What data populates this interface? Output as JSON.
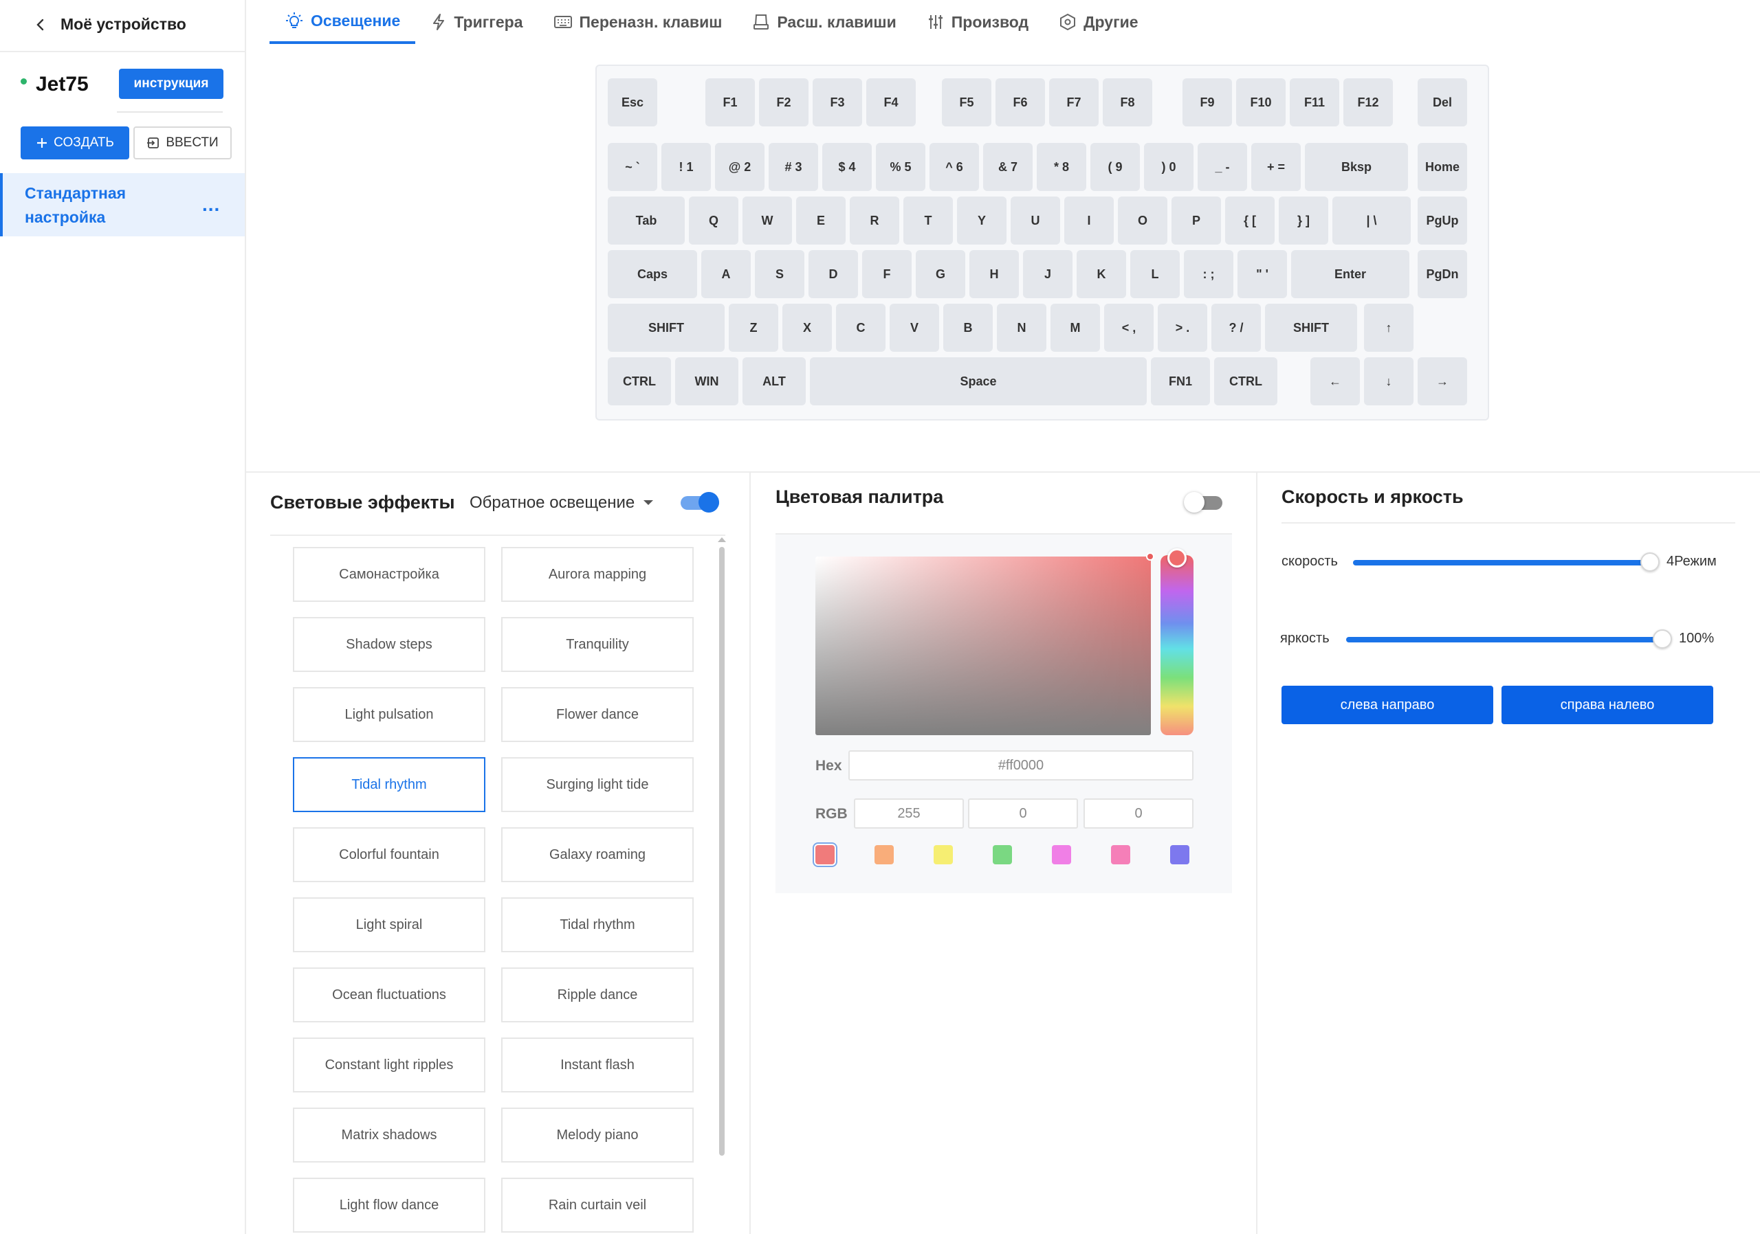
{
  "sidebar": {
    "back_title": "Моё устройство",
    "device_name": "Jet75",
    "instruction_label": "инструкция",
    "create_label": "СОЗДАТЬ",
    "import_label": "ВВЕСТИ",
    "profile_name": "Стандартная настройка",
    "profile_more": "..."
  },
  "tabs": [
    {
      "label": "Освещение",
      "icon": "bulb-icon",
      "active": true
    },
    {
      "label": "Триггера",
      "icon": "lightning-icon"
    },
    {
      "label": "Переназн. клавиш",
      "icon": "keyboard-icon"
    },
    {
      "label": "Расш. клавиши",
      "icon": "device-icon"
    },
    {
      "label": "Производ",
      "icon": "sliders-icon"
    },
    {
      "label": "Другие",
      "icon": "hexagon-settings-icon"
    }
  ],
  "keyboard": {
    "rows": [
      [
        "Esc",
        "F1",
        "F2",
        "F3",
        "F4",
        "F5",
        "F6",
        "F7",
        "F8",
        "F9",
        "F10",
        "F11",
        "F12",
        "Del"
      ],
      [
        "~ `",
        "! 1",
        "@ 2",
        "# 3",
        "$ 4",
        "% 5",
        "^ 6",
        "& 7",
        "* 8",
        "( 9",
        ") 0",
        "_ -",
        "+ =",
        "Bksp",
        "Home"
      ],
      [
        "Tab",
        "Q",
        "W",
        "E",
        "R",
        "T",
        "Y",
        "U",
        "I",
        "O",
        "P",
        "{ [",
        "} ]",
        "| \\",
        "PgUp"
      ],
      [
        "Caps",
        "A",
        "S",
        "D",
        "F",
        "G",
        "H",
        "J",
        "K",
        "L",
        ": ;",
        "\" '",
        "Enter",
        "PgDn"
      ],
      [
        "SHIFT",
        "Z",
        "X",
        "C",
        "V",
        "B",
        "N",
        "M",
        "< ,",
        "> .",
        "? /",
        "SHIFT",
        "↑"
      ],
      [
        "CTRL",
        "WIN",
        "ALT",
        "Space",
        "FN1",
        "CTRL",
        "←",
        "↓",
        "→"
      ]
    ]
  },
  "effects": {
    "title": "Световые эффекты",
    "mode": "Обратное освещение",
    "enabled": true,
    "selected": "Tidal rhythm",
    "items": [
      "Самонастройка",
      "Aurora mapping",
      "Shadow steps",
      "Tranquility",
      "Light pulsation",
      "Flower dance",
      "Tidal rhythm",
      "Surging light tide",
      "Colorful fountain",
      "Galaxy roaming",
      "Light spiral",
      "Tidal rhythm",
      "Ocean fluctuations",
      "Ripple dance",
      "Constant light ripples",
      "Instant flash",
      "Matrix shadows",
      "Melody piano",
      "Light flow dance",
      "Rain curtain veil"
    ]
  },
  "palette": {
    "title": "Цветовая палитра",
    "enabled": false,
    "hex_label": "Hex",
    "hex_value": "#ff0000",
    "rgb_label": "RGB",
    "rgb": [
      "255",
      "0",
      "0"
    ],
    "swatches": [
      "#f07b7b",
      "#f9ad7a",
      "#f6ee72",
      "#7ad882",
      "#f07fe6",
      "#f57fb8",
      "#7d78ee"
    ],
    "selected_swatch": 0
  },
  "speed_brightness": {
    "title": "Скорость и яркость",
    "speed_label": "скорость",
    "speed_value": "4Режим",
    "speed_level": 4,
    "brightness_label": "яркость",
    "brightness_value": "100%",
    "left_to_right": "слева направо",
    "right_to_left": "справа налево"
  },
  "colors": {
    "accent": "#1a73e8",
    "key_bg": "#e4e7ec"
  }
}
